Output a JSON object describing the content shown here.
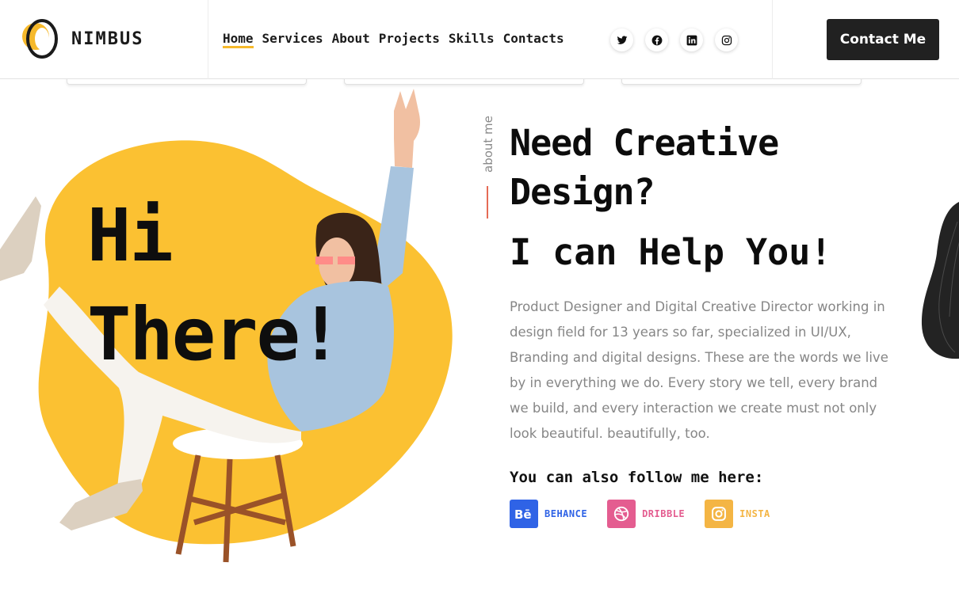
{
  "brand": {
    "name": "NIMBUS"
  },
  "nav": {
    "items": [
      {
        "label": "Home",
        "active": true
      },
      {
        "label": "Services",
        "active": false
      },
      {
        "label": "About",
        "active": false
      },
      {
        "label": "Projects",
        "active": false
      },
      {
        "label": "Skills",
        "active": false
      },
      {
        "label": "Contacts",
        "active": false
      }
    ]
  },
  "header_socials": [
    "twitter-icon",
    "facebook-icon",
    "linkedin-icon",
    "instagram-icon"
  ],
  "contact_button": "Contact Me",
  "hero": {
    "greeting_line1": "Hi",
    "greeting_line2": "There!",
    "section_label": "about me",
    "heading_line1": "Need Creative Design?",
    "heading_line2": "I can Help You!",
    "bio": "Product Designer and Digital Creative Director working in design field for 13 years so far, specialized in UI/UX, Branding and digital designs. These are the words we live by in everything we do. Every story we tell, every brand we build, and every interaction we create must not only look beautiful. beautifully, too.",
    "follow_title": "You can also follow me here:",
    "follow_links": [
      {
        "label": "BEHANCE",
        "icon": "behance-icon",
        "color": "#2f63e6"
      },
      {
        "label": "DRIBBLE",
        "icon": "dribbble-icon",
        "color": "#e45d90"
      },
      {
        "label": "INSTA",
        "icon": "instagram-icon",
        "color": "#f4b544"
      }
    ]
  },
  "colors": {
    "accent": "#f6b92b",
    "blob": "#fbc132",
    "dark_button": "#212121",
    "about_line": "#e56b55"
  }
}
